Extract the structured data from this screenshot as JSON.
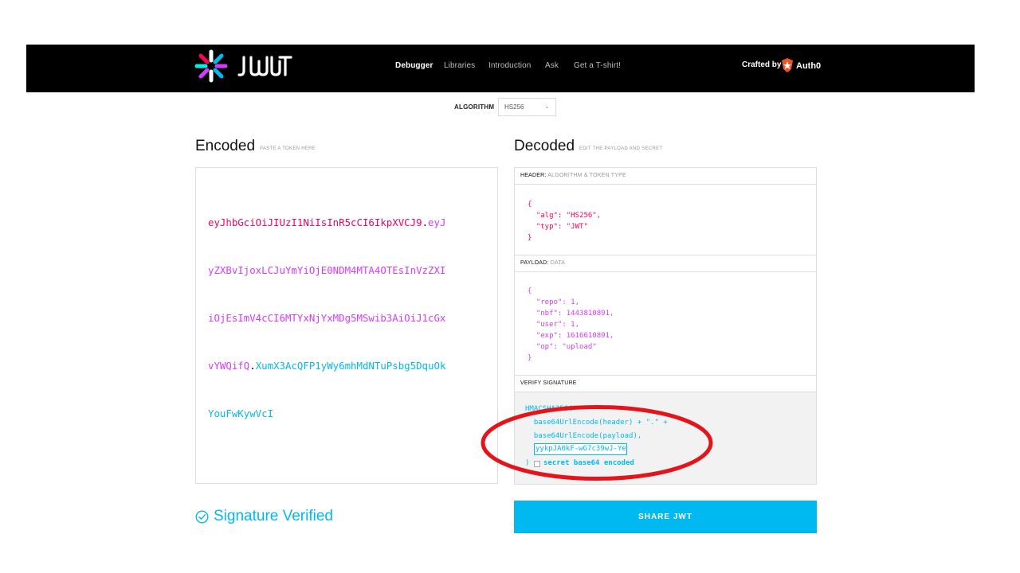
{
  "nav": {
    "brand": "JWT",
    "items": [
      "Debugger",
      "Libraries",
      "Introduction",
      "Ask",
      "Get a T-shirt!"
    ],
    "crafted_by": "Crafted by",
    "partner": "Auth0"
  },
  "algorithm": {
    "label": "ALGORITHM",
    "value": "HS256"
  },
  "encoded": {
    "title": "Encoded",
    "subtitle": "PASTE A TOKEN HERE",
    "lines": [
      [
        {
          "t": "h",
          "v": "eyJhbGciOiJIUzI1NiIsInR5cCI6IkpXVCJ9"
        },
        {
          "t": "d",
          "v": "."
        },
        {
          "t": "p",
          "v": "eyJ"
        }
      ],
      [
        {
          "t": "p",
          "v": "yZXBvIjoxLCJuYmYiOjE0NDM4MTA4OTEsInVzZXI"
        }
      ],
      [
        {
          "t": "p",
          "v": "iOjEsImV4cCI6MTYxNjYxMDg5MSwib3AiOiJ1cGx"
        }
      ],
      [
        {
          "t": "p",
          "v": "vYWQifQ"
        },
        {
          "t": "d",
          "v": "."
        },
        {
          "t": "s",
          "v": "XumX3AcQFP1yWy6mhMdNTuPsbg5DquOk"
        }
      ],
      [
        {
          "t": "s",
          "v": "YouFwKywVcI"
        }
      ]
    ]
  },
  "decoded": {
    "title": "Decoded",
    "subtitle": "EDIT THE PAYLOAD AND SECRET",
    "header_label": "HEADER:",
    "header_sub": "ALGORITHM & TOKEN TYPE",
    "header_json": "{\n  \"alg\": \"HS256\",\n  \"typ\": \"JWT\"\n}",
    "payload_label": "PAYLOAD:",
    "payload_sub": "DATA",
    "payload_json": "{\n  \"repo\": 1,\n  \"nbf\": 1443810891,\n  \"user\": 1,\n  \"exp\": 1616610891,\n  \"op\": \"upload\"\n}",
    "verify_label": "VERIFY SIGNATURE",
    "sig_fn": "HMACSHA256(",
    "sig_line1": "  base64UrlEncode(header) + \".\" +",
    "sig_line2": "  base64UrlEncode(payload),",
    "secret_value": "yykpJA0kF-wG7c39wJ-Ye",
    "close_paren": ")",
    "secret_b64_label": "secret base64 encoded"
  },
  "footer": {
    "status": "Signature Verified",
    "share": "SHARE JWT"
  },
  "colors": {
    "header_red": "#fb015b",
    "payload_purple": "#d63aff",
    "signature_blue": "#00b9f1",
    "annotation_red": "#e3141a"
  }
}
